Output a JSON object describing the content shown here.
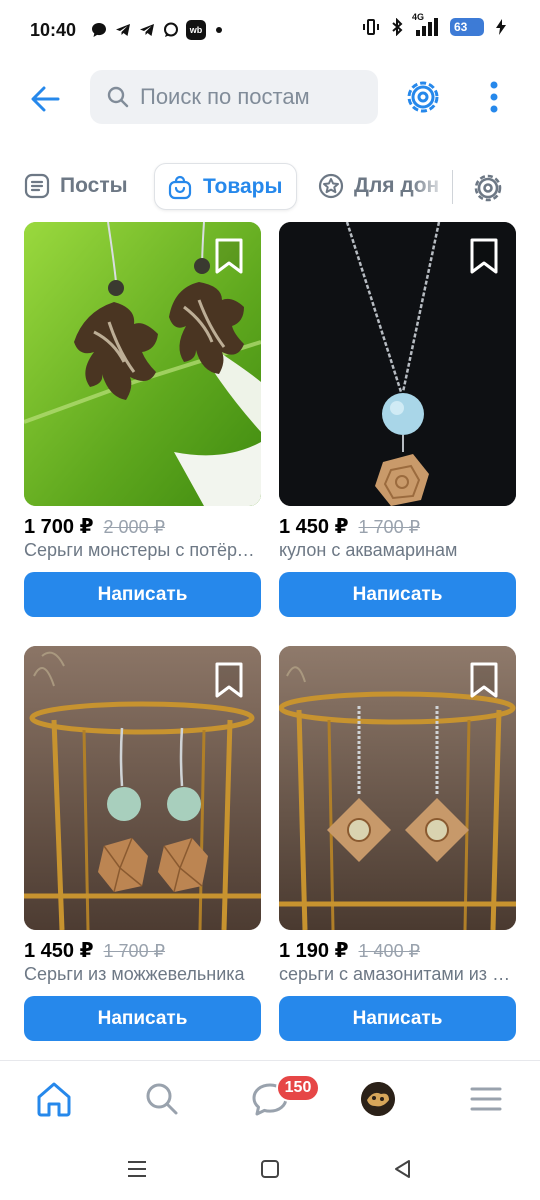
{
  "status_bar": {
    "time": "10:40",
    "network": "4G",
    "battery": "63",
    "left_icons": [
      "chat-icon",
      "telegram-icon",
      "telegram-icon",
      "whatsapp-icon",
      "wb-icon"
    ],
    "wb_label": "wb"
  },
  "header": {
    "search_placeholder": "Поиск по постам"
  },
  "tabs": [
    {
      "label": "Посты",
      "icon": "list-icon"
    },
    {
      "label": "Товары",
      "icon": "bag-icon",
      "active": true
    },
    {
      "label": "Для дон",
      "icon": "donut-icon"
    }
  ],
  "products": [
    {
      "price": "1 700 ₽",
      "old_price": "2 000 ₽",
      "title": "Серьги монстеры с потёртостями",
      "button": "Написать"
    },
    {
      "price": "1 450 ₽",
      "old_price": "1 700 ₽",
      "title": "кулон с аквамаринам",
      "button": "Написать"
    },
    {
      "price": "1 450 ₽",
      "old_price": "1 700 ₽",
      "title": "Серьги из можжевельника",
      "button": "Написать"
    },
    {
      "price": "1 190 ₽",
      "old_price": "1 400 ₽",
      "title": "серьги с амазонитами из дерева",
      "button": "Написать"
    }
  ],
  "bottom_nav": {
    "messages_badge": "150",
    "items": [
      "home-icon",
      "search-icon",
      "messages-icon",
      "profile-avatar",
      "menu-icon"
    ]
  },
  "colors": {
    "accent": "#2688eb",
    "badge": "#e64646",
    "secondary_text": "#6d7885"
  }
}
